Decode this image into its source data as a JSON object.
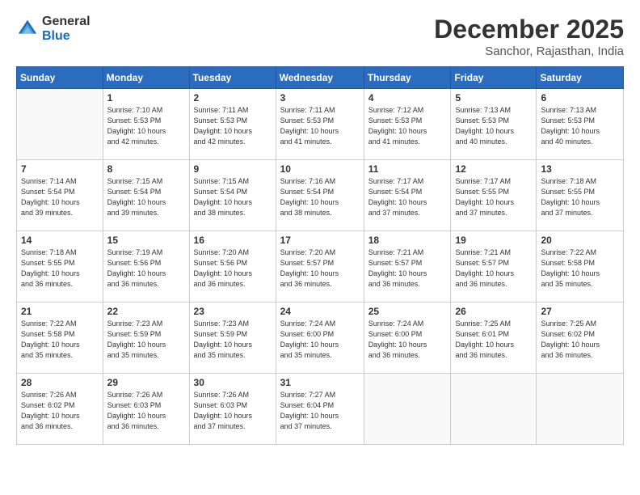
{
  "logo": {
    "general": "General",
    "blue": "Blue",
    "icon_color": "#1a6bb5"
  },
  "title": "December 2025",
  "subtitle": "Sanchor, Rajasthan, India",
  "days_of_week": [
    "Sunday",
    "Monday",
    "Tuesday",
    "Wednesday",
    "Thursday",
    "Friday",
    "Saturday"
  ],
  "weeks": [
    [
      {
        "day": "",
        "info": ""
      },
      {
        "day": "1",
        "info": "Sunrise: 7:10 AM\nSunset: 5:53 PM\nDaylight: 10 hours\nand 42 minutes."
      },
      {
        "day": "2",
        "info": "Sunrise: 7:11 AM\nSunset: 5:53 PM\nDaylight: 10 hours\nand 42 minutes."
      },
      {
        "day": "3",
        "info": "Sunrise: 7:11 AM\nSunset: 5:53 PM\nDaylight: 10 hours\nand 41 minutes."
      },
      {
        "day": "4",
        "info": "Sunrise: 7:12 AM\nSunset: 5:53 PM\nDaylight: 10 hours\nand 41 minutes."
      },
      {
        "day": "5",
        "info": "Sunrise: 7:13 AM\nSunset: 5:53 PM\nDaylight: 10 hours\nand 40 minutes."
      },
      {
        "day": "6",
        "info": "Sunrise: 7:13 AM\nSunset: 5:53 PM\nDaylight: 10 hours\nand 40 minutes."
      }
    ],
    [
      {
        "day": "7",
        "info": "Sunrise: 7:14 AM\nSunset: 5:54 PM\nDaylight: 10 hours\nand 39 minutes."
      },
      {
        "day": "8",
        "info": "Sunrise: 7:15 AM\nSunset: 5:54 PM\nDaylight: 10 hours\nand 39 minutes."
      },
      {
        "day": "9",
        "info": "Sunrise: 7:15 AM\nSunset: 5:54 PM\nDaylight: 10 hours\nand 38 minutes."
      },
      {
        "day": "10",
        "info": "Sunrise: 7:16 AM\nSunset: 5:54 PM\nDaylight: 10 hours\nand 38 minutes."
      },
      {
        "day": "11",
        "info": "Sunrise: 7:17 AM\nSunset: 5:54 PM\nDaylight: 10 hours\nand 37 minutes."
      },
      {
        "day": "12",
        "info": "Sunrise: 7:17 AM\nSunset: 5:55 PM\nDaylight: 10 hours\nand 37 minutes."
      },
      {
        "day": "13",
        "info": "Sunrise: 7:18 AM\nSunset: 5:55 PM\nDaylight: 10 hours\nand 37 minutes."
      }
    ],
    [
      {
        "day": "14",
        "info": "Sunrise: 7:18 AM\nSunset: 5:55 PM\nDaylight: 10 hours\nand 36 minutes."
      },
      {
        "day": "15",
        "info": "Sunrise: 7:19 AM\nSunset: 5:56 PM\nDaylight: 10 hours\nand 36 minutes."
      },
      {
        "day": "16",
        "info": "Sunrise: 7:20 AM\nSunset: 5:56 PM\nDaylight: 10 hours\nand 36 minutes."
      },
      {
        "day": "17",
        "info": "Sunrise: 7:20 AM\nSunset: 5:57 PM\nDaylight: 10 hours\nand 36 minutes."
      },
      {
        "day": "18",
        "info": "Sunrise: 7:21 AM\nSunset: 5:57 PM\nDaylight: 10 hours\nand 36 minutes."
      },
      {
        "day": "19",
        "info": "Sunrise: 7:21 AM\nSunset: 5:57 PM\nDaylight: 10 hours\nand 36 minutes."
      },
      {
        "day": "20",
        "info": "Sunrise: 7:22 AM\nSunset: 5:58 PM\nDaylight: 10 hours\nand 35 minutes."
      }
    ],
    [
      {
        "day": "21",
        "info": "Sunrise: 7:22 AM\nSunset: 5:58 PM\nDaylight: 10 hours\nand 35 minutes."
      },
      {
        "day": "22",
        "info": "Sunrise: 7:23 AM\nSunset: 5:59 PM\nDaylight: 10 hours\nand 35 minutes."
      },
      {
        "day": "23",
        "info": "Sunrise: 7:23 AM\nSunset: 5:59 PM\nDaylight: 10 hours\nand 35 minutes."
      },
      {
        "day": "24",
        "info": "Sunrise: 7:24 AM\nSunset: 6:00 PM\nDaylight: 10 hours\nand 35 minutes."
      },
      {
        "day": "25",
        "info": "Sunrise: 7:24 AM\nSunset: 6:00 PM\nDaylight: 10 hours\nand 36 minutes."
      },
      {
        "day": "26",
        "info": "Sunrise: 7:25 AM\nSunset: 6:01 PM\nDaylight: 10 hours\nand 36 minutes."
      },
      {
        "day": "27",
        "info": "Sunrise: 7:25 AM\nSunset: 6:02 PM\nDaylight: 10 hours\nand 36 minutes."
      }
    ],
    [
      {
        "day": "28",
        "info": "Sunrise: 7:26 AM\nSunset: 6:02 PM\nDaylight: 10 hours\nand 36 minutes."
      },
      {
        "day": "29",
        "info": "Sunrise: 7:26 AM\nSunset: 6:03 PM\nDaylight: 10 hours\nand 36 minutes."
      },
      {
        "day": "30",
        "info": "Sunrise: 7:26 AM\nSunset: 6:03 PM\nDaylight: 10 hours\nand 37 minutes."
      },
      {
        "day": "31",
        "info": "Sunrise: 7:27 AM\nSunset: 6:04 PM\nDaylight: 10 hours\nand 37 minutes."
      },
      {
        "day": "",
        "info": ""
      },
      {
        "day": "",
        "info": ""
      },
      {
        "day": "",
        "info": ""
      }
    ]
  ]
}
